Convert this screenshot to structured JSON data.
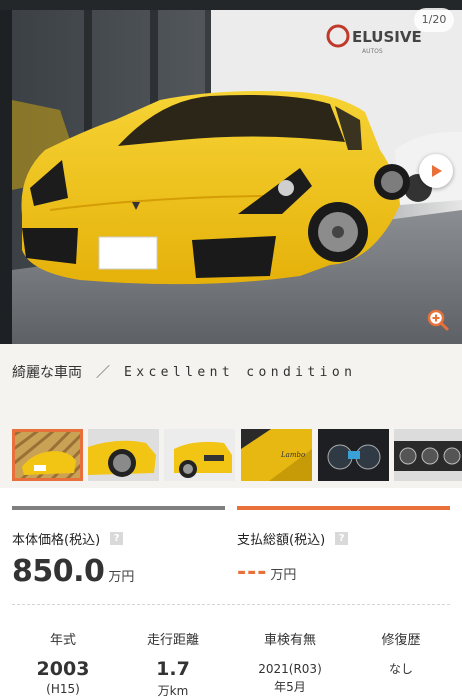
{
  "gallery": {
    "counter": "1/20",
    "dealer_logo_text": "ELUSIVE AUTOS"
  },
  "caption": {
    "jp": "綺麗な車両",
    "separator": "／",
    "en": "Excellent condition"
  },
  "thumbnails": [
    {
      "name": "front-view",
      "active": true
    },
    {
      "name": "side-wheel-view",
      "active": false
    },
    {
      "name": "rear-view",
      "active": false
    },
    {
      "name": "badge-closeup",
      "active": false
    },
    {
      "name": "dashboard-gauges",
      "active": false
    },
    {
      "name": "interior-console",
      "active": false
    }
  ],
  "price": {
    "base_label": "本体価格(税込)",
    "base_value": "850.0",
    "base_unit": "万円",
    "total_label": "支払総額(税込)",
    "total_value": "---",
    "total_unit": "万円",
    "help_glyph": "?"
  },
  "specs": [
    {
      "label": "年式",
      "value": "2003",
      "sub": "(H15)"
    },
    {
      "label": "走行距離",
      "value": "1.7",
      "sub": "万km"
    },
    {
      "label": "車検有無",
      "value": "2021(R03)",
      "sub": "年5月"
    },
    {
      "label": "修復歴",
      "value": "なし",
      "sub": ""
    }
  ],
  "colors": {
    "accent": "#e8703a",
    "car_yellow": "#f2c414",
    "panel_bg": "#f4f3ef"
  }
}
